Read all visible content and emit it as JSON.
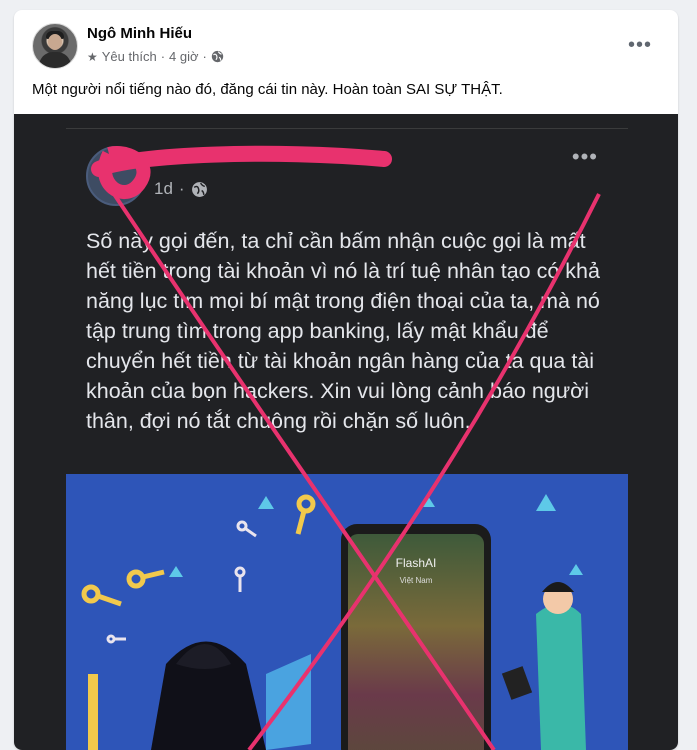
{
  "post": {
    "author": "Ngô Minh Hiếu",
    "meta_label": "Yêu thích",
    "time": "4 giờ",
    "dot": "·",
    "more": "•••",
    "caption": "Một người nổi tiếng nào đó, đăng cái tin này. Hoàn toàn SAI SỰ THẬT."
  },
  "shared": {
    "time": "1d",
    "dot": "·",
    "more": "•••",
    "text": "Số này gọi đến, ta chỉ cần bấm nhận cuộc gọi là mất hết tiền trong tài khoản vì nó là trí tuệ nhân tạo có khả năng lục tìm mọi bí mật trong điện thoại của ta, mà nó tập trung tìm trong app banking, lấy mật khẩu để chuyển hết tiền từ tài khoản ngân hàng của ta qua tài khoản của bọn hackers. Xin vui lòng cảnh báo người thân, đợi nó tắt chuông rồi chặn số luôn.",
    "app_name": "FlashAI",
    "app_sub": "Việt Nam"
  },
  "colors": {
    "scribble": "#e8326e",
    "card_bg": "#202124",
    "image_bg": "#2e55b8"
  }
}
